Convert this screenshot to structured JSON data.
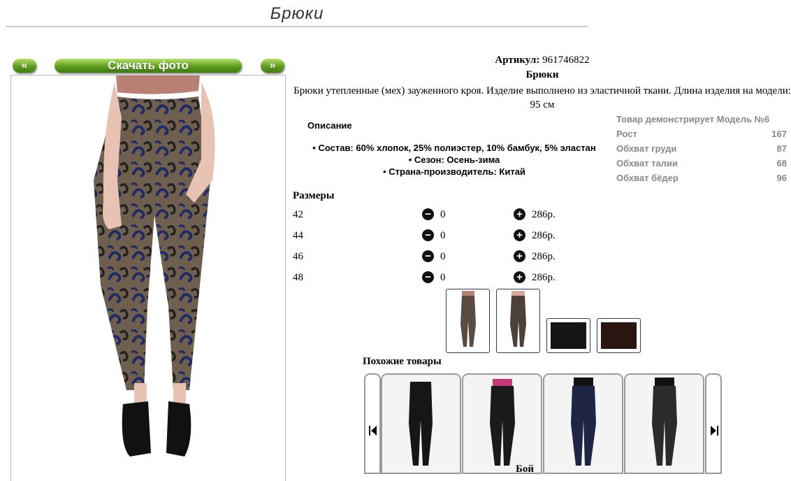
{
  "page": {
    "title": "Брюки"
  },
  "photo_nav": {
    "prev": "«",
    "download": "Скачать фото",
    "next": "»"
  },
  "product": {
    "articul_label": "Артикул:",
    "articul_value": "961746822",
    "name": "Брюки",
    "description": "Брюки утепленные (мех) зауженного кроя. Изделие выполнено из эластичной ткани. Длина изделия на модели: 95 см"
  },
  "details": {
    "heading": "Описание",
    "items": [
      "Состав: 60% хлопок, 25% полиэстер, 10% бамбук, 5% эластан",
      "Сезон: Осень-зима",
      "Страна-производитель: Китай"
    ]
  },
  "model": {
    "heading": "Товар демонстрирует Модель №6",
    "rows": [
      {
        "label": "Рост",
        "value": "167"
      },
      {
        "label": "Обхват груди",
        "value": "87"
      },
      {
        "label": "Обхват талии",
        "value": "68"
      },
      {
        "label": "Обхват бёдер",
        "value": "96"
      }
    ]
  },
  "sizes": {
    "heading": "Размеры",
    "rows": [
      {
        "size": "42",
        "qty": "0",
        "price": "286р."
      },
      {
        "size": "44",
        "qty": "0",
        "price": "286р."
      },
      {
        "size": "46",
        "qty": "0",
        "price": "286р."
      },
      {
        "size": "48",
        "qty": "0",
        "price": "286р."
      }
    ]
  },
  "similar": {
    "heading": "Похожие товары"
  },
  "cut_text": "Бой",
  "colors": {
    "accent_green": "#5d9d1e",
    "thumb_border": "#2c3e66",
    "pattern_bg": "#6e5f4f",
    "pattern_navy": "#1f2a66"
  }
}
